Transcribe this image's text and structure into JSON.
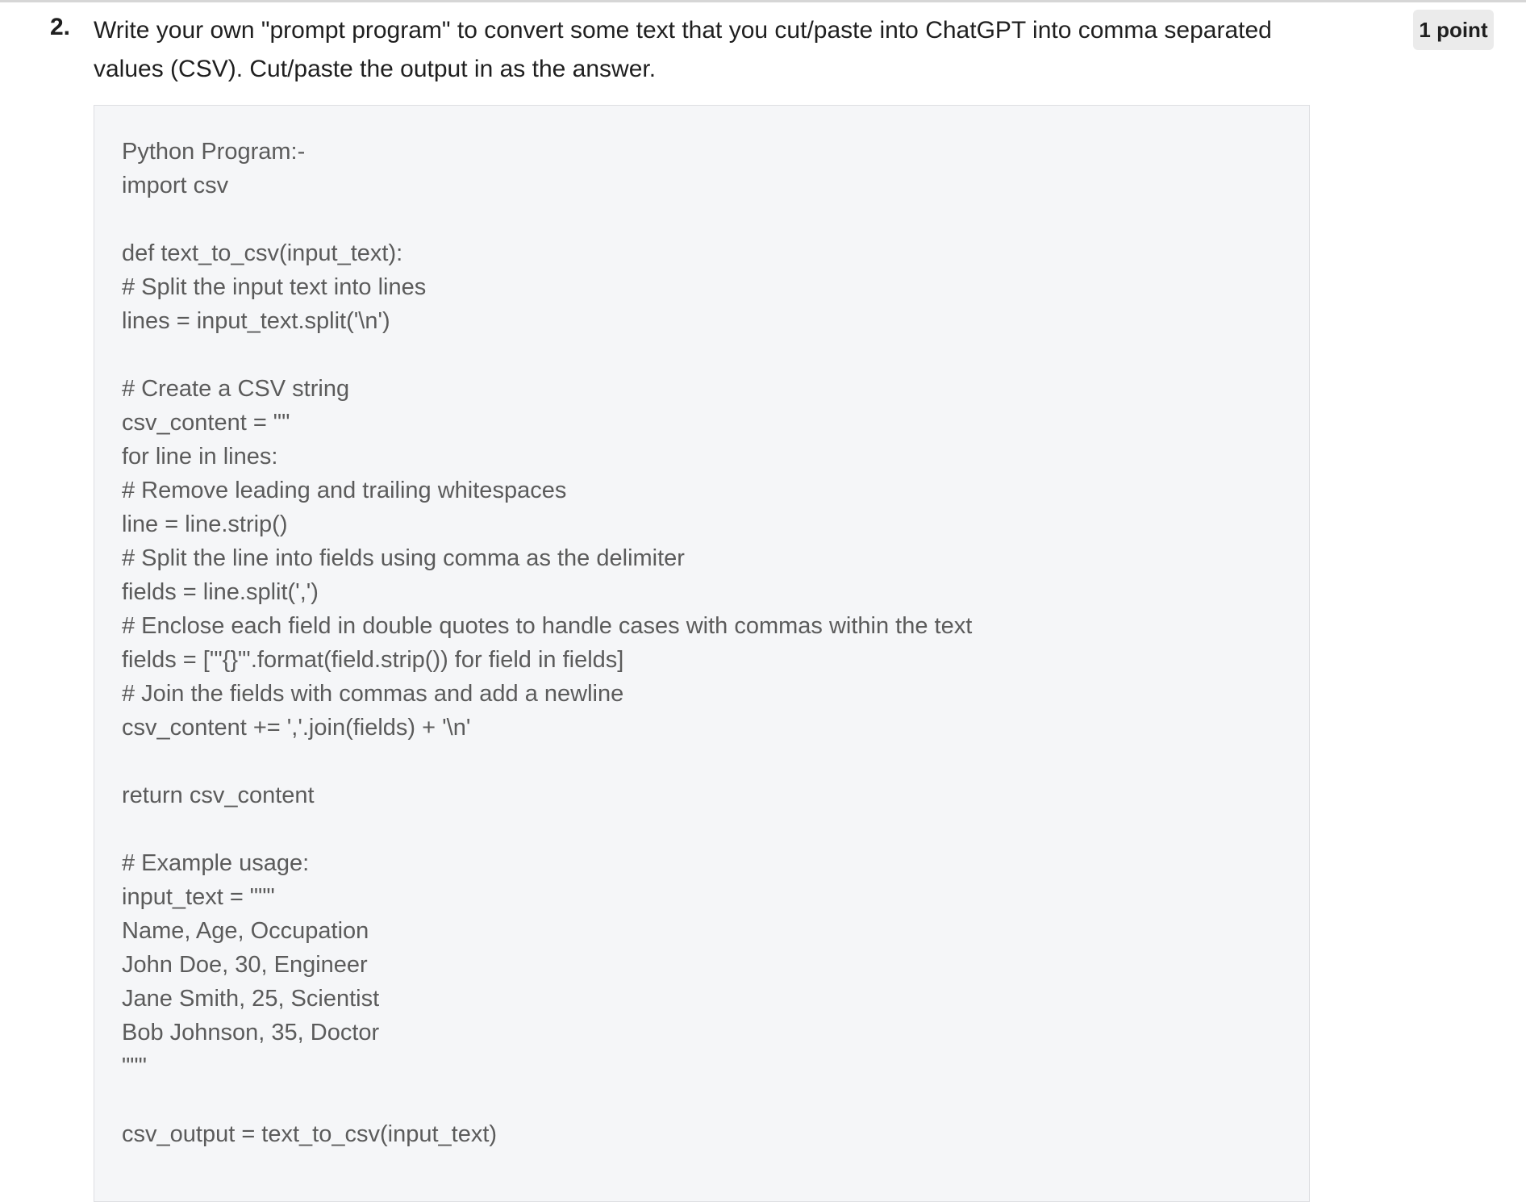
{
  "question": {
    "number": "2.",
    "text": "Write your own \"prompt program\" to convert some text that you cut/paste into ChatGPT into comma separated values (CSV). Cut/paste the output in as the answer.",
    "points": "1 point"
  },
  "answer": {
    "lines": [
      "Python Program:-",
      "import csv",
      "",
      "def text_to_csv(input_text):",
      "# Split the input text into lines",
      "lines = input_text.split('\\n')",
      "",
      "# Create a CSV string",
      "csv_content = \"\"",
      "for line in lines:",
      "# Remove leading and trailing whitespaces",
      "line = line.strip()",
      "# Split the line into fields using comma as the delimiter",
      "fields = line.split(',')",
      "# Enclose each field in double quotes to handle cases with commas within the text",
      "fields = ['\"{}\"'.format(field.strip()) for field in fields]",
      "# Join the fields with commas and add a newline",
      "csv_content += ','.join(fields) + '\\n'",
      "",
      "return csv_content",
      "",
      "# Example usage:",
      "input_text = \"\"\"",
      "Name, Age, Occupation",
      "John Doe, 30, Engineer",
      "Jane Smith, 25, Scientist",
      "Bob Johnson, 35, Doctor",
      "\"\"\"",
      "",
      "csv_output = text_to_csv(input_text)"
    ]
  }
}
